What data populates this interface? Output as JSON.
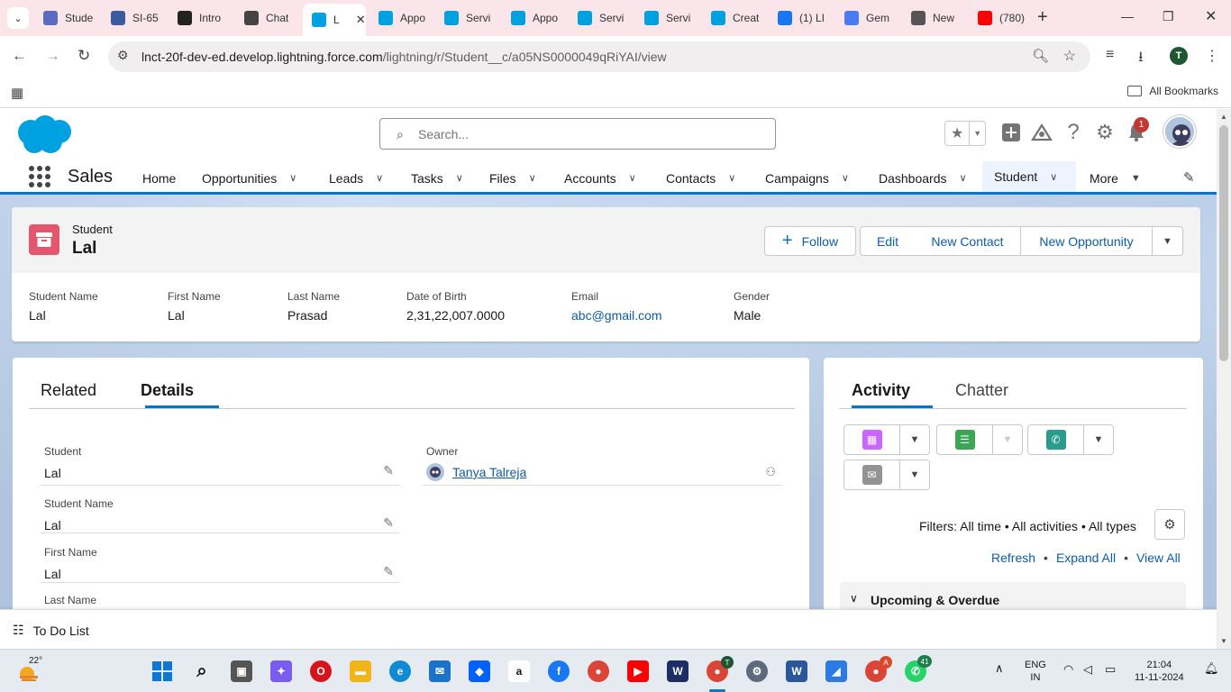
{
  "browser": {
    "tabs": [
      {
        "title": "Stude",
        "icon": "ms-forms-icon",
        "color": "#5b6bbf"
      },
      {
        "title": "SI-65",
        "icon": "edit-doc-icon",
        "color": "#3a5ba0"
      },
      {
        "title": "Intro",
        "icon": "notion-icon",
        "color": "#222222"
      },
      {
        "title": "Chat",
        "icon": "chatgpt-icon",
        "color": "#444444"
      },
      {
        "title": "L",
        "icon": "salesforce-icon",
        "color": "#00a1e0",
        "active": true
      },
      {
        "title": "Appo",
        "icon": "salesforce-icon",
        "color": "#00a1e0"
      },
      {
        "title": "Servi",
        "icon": "salesforce-icon",
        "color": "#00a1e0"
      },
      {
        "title": "Appo",
        "icon": "salesforce-icon",
        "color": "#00a1e0"
      },
      {
        "title": "Servi",
        "icon": "salesforce-icon",
        "color": "#00a1e0"
      },
      {
        "title": "Servi",
        "icon": "salesforce-icon",
        "color": "#00a1e0"
      },
      {
        "title": "Creat",
        "icon": "salesforce-icon",
        "color": "#00a1e0"
      },
      {
        "title": "(1) LI",
        "icon": "facebook-icon",
        "color": "#1877f2"
      },
      {
        "title": "Gem",
        "icon": "gemini-icon",
        "color": "#4a7bf7"
      },
      {
        "title": "New",
        "icon": "chrome-icon",
        "color": "#555555"
      },
      {
        "title": "(780)",
        "icon": "youtube-icon",
        "color": "#ff0000"
      }
    ],
    "url_host": "lnct-20f-dev-ed.develop.lightning.force.com",
    "url_path": "/lightning/r/Student__c/a05NS0000049qRiYAI/view",
    "profile_initial": "T",
    "all_bookmarks": "All Bookmarks"
  },
  "header": {
    "search_placeholder": "Search...",
    "notification_count": "1"
  },
  "appnav": {
    "app_name": "Sales",
    "items": [
      {
        "label": "Home",
        "has_menu": false
      },
      {
        "label": "Opportunities",
        "has_menu": true
      },
      {
        "label": "Leads",
        "has_menu": true
      },
      {
        "label": "Tasks",
        "has_menu": true
      },
      {
        "label": "Files",
        "has_menu": true
      },
      {
        "label": "Accounts",
        "has_menu": true
      },
      {
        "label": "Contacts",
        "has_menu": true
      },
      {
        "label": "Campaigns",
        "has_menu": true
      },
      {
        "label": "Dashboards",
        "has_menu": true
      },
      {
        "label": "Student",
        "has_menu": true,
        "active": true
      },
      {
        "label": "More",
        "has_menu": true
      }
    ]
  },
  "record": {
    "object_label": "Student",
    "name": "Lal",
    "buttons": {
      "follow": "Follow",
      "edit": "Edit",
      "new_contact": "New Contact",
      "new_opportunity": "New Opportunity"
    },
    "highlights": [
      {
        "label": "Student Name",
        "value": "Lal"
      },
      {
        "label": "First Name",
        "value": "Lal"
      },
      {
        "label": "Last Name",
        "value": "Prasad"
      },
      {
        "label": "Date of Birth",
        "value": "2,31,22,007.0000"
      },
      {
        "label": "Email",
        "value": "abc@gmail.com"
      },
      {
        "label": "Gender",
        "value": "Male"
      }
    ]
  },
  "details": {
    "tabs": [
      "Related",
      "Details"
    ],
    "active_tab": "Details",
    "fields": [
      {
        "label": "Student",
        "value": "Lal"
      },
      {
        "label": "Student Name",
        "value": "Lal"
      },
      {
        "label": "First Name",
        "value": "Lal"
      },
      {
        "label": "Last Name",
        "value": ""
      }
    ],
    "owner_label": "Owner",
    "owner_name": "Tanya Talreja"
  },
  "activity": {
    "tabs": [
      "Activity",
      "Chatter"
    ],
    "active_tab": "Activity",
    "filters": "Filters: All time • All activities • All types",
    "links": {
      "refresh": "Refresh",
      "expand_all": "Expand All",
      "view_all": "View All"
    },
    "section": "Upcoming & Overdue",
    "colors": {
      "event": "#cb65ff",
      "task": "#3ba755",
      "call": "#2a9c8b",
      "email": "#939393"
    }
  },
  "utility": {
    "todo": "To Do List"
  },
  "taskbar": {
    "temperature": "22°",
    "lang_top": "ENG",
    "lang_bottom": "IN",
    "time": "21:04",
    "date": "11-11-2024",
    "whatsapp_badge": "41",
    "chrome_badge": "T"
  },
  "colors": {
    "accent": "#0176d3",
    "link": "#0b5cab",
    "object_icon": "#e3566b",
    "tabstrip": "#f9e5ea"
  }
}
